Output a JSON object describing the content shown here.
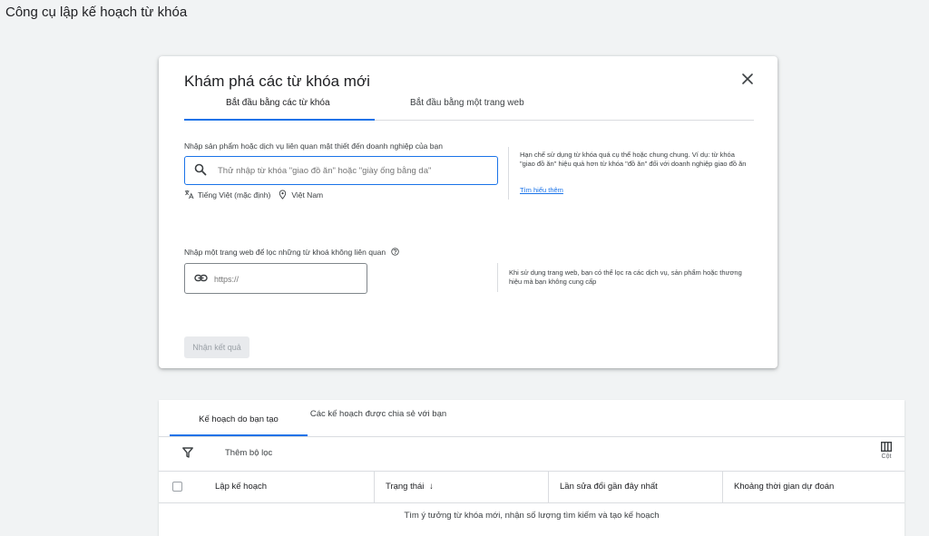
{
  "app": {
    "title": "Công cụ lập kế hoạch từ khóa"
  },
  "modal": {
    "title": "Khám phá các từ khóa mới",
    "tabs": [
      {
        "label": "Bắt đầu bằng các từ khóa",
        "active": true
      },
      {
        "label": "Bắt đầu bằng một trang web",
        "active": false
      }
    ],
    "keywords_section": {
      "label": "Nhập sản phẩm hoặc dịch vụ liên quan mật thiết đến doanh nghiệp của bạn",
      "placeholder": "Thử nhập từ khóa \"giao đồ ăn\" hoặc \"giày ống bằng da\"",
      "language": "Tiếng Việt (mặc định)",
      "location": "Việt Nam",
      "tip_text": "Hạn chế sử dụng từ khóa quá cụ thể hoặc chung chung. Ví dụ: từ khóa \"giao đồ ăn\" hiệu quả hơn từ khóa \"đồ ăn\" đối với doanh nghiệp giao đồ ăn",
      "learn_more": "Tìm hiểu thêm"
    },
    "website_section": {
      "label": "Nhập một trang web để lọc những từ khoá không liên quan",
      "placeholder": "https://",
      "tip_text": "Khi sử dụng trang web, bạn có thể lọc ra các dịch vụ, sản phẩm hoặc thương hiệu mà bạn không cung cấp"
    },
    "get_results_label": "Nhận kết quả"
  },
  "plans": {
    "tabs": [
      {
        "label": "Kế hoạch do bạn tạo",
        "active": true
      },
      {
        "label": "Các kế hoạch được chia sẻ với bạn",
        "active": false
      }
    ],
    "add_filter_label": "Thêm bộ lọc",
    "columns_label": "Cột",
    "headers": [
      "Lập kế hoạch",
      "Trạng thái",
      "Lần sửa đổi gần đây nhất",
      "Khoảng thời gian dự đoán"
    ],
    "sort_indicator": "↓",
    "empty_message": "Tìm ý tưởng từ khóa mới, nhận số lượng tìm kiếm và tạo kế hoạch"
  },
  "colors": {
    "accent": "#1a73e8",
    "background": "#f1f3f4"
  },
  "icons": {
    "close": "close-icon",
    "search": "search-icon",
    "translate": "translate-icon",
    "location": "location-pin-icon",
    "help": "help-icon",
    "link": "link-icon",
    "filter": "filter-icon",
    "columns": "columns-icon"
  }
}
